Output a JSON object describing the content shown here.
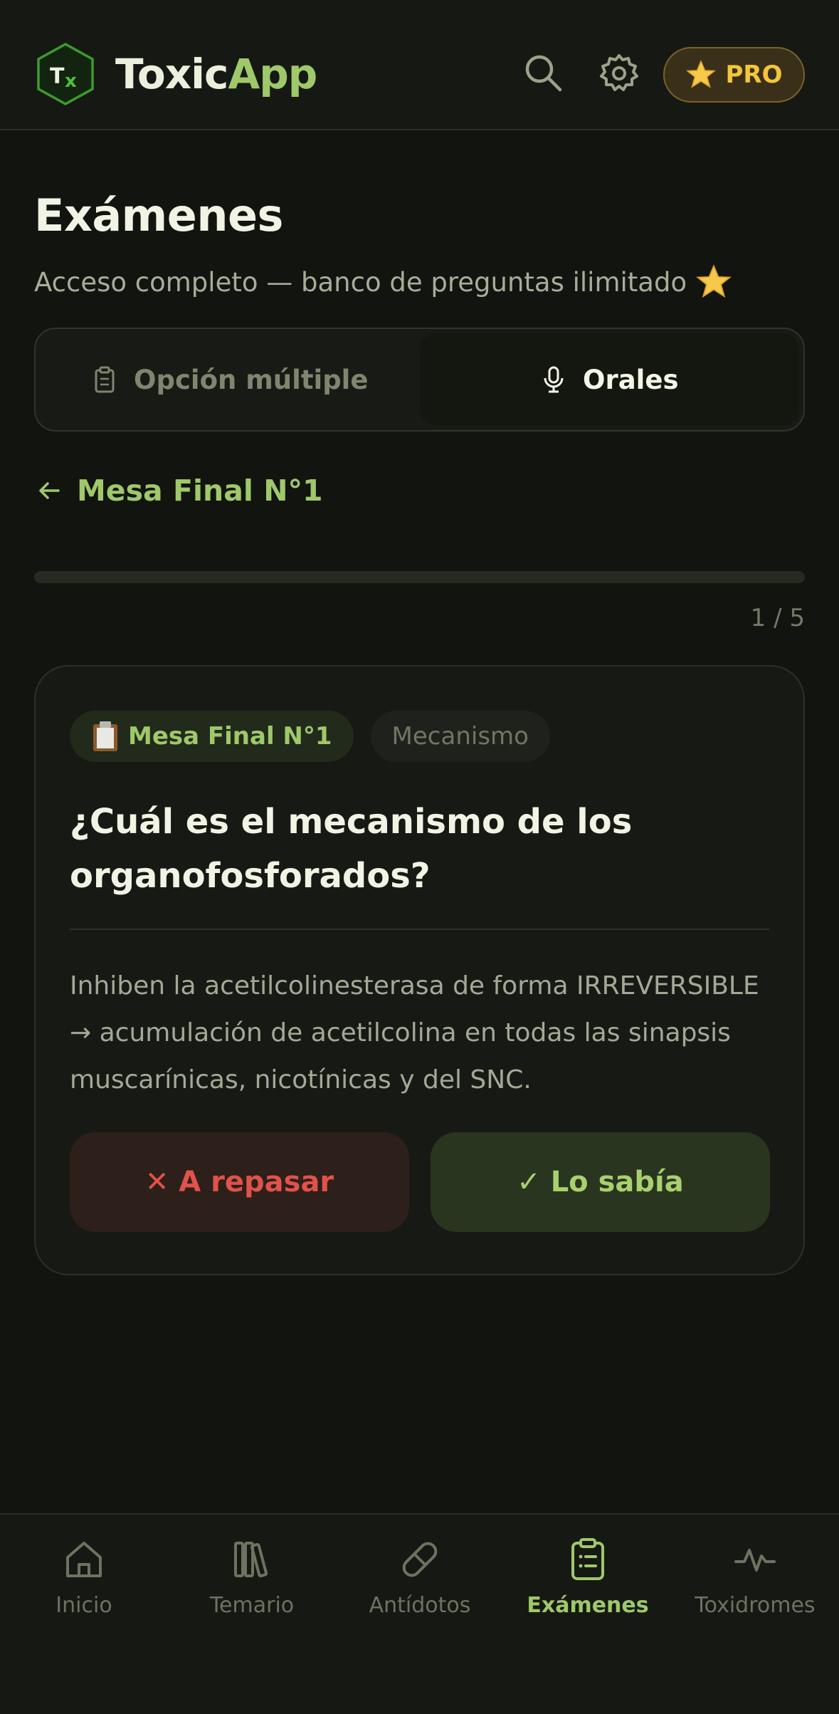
{
  "header": {
    "logo_text": "Tx",
    "brand_part1": "Toxic",
    "brand_part2": "App",
    "pro_label": "PRO"
  },
  "page": {
    "title": "Exámenes",
    "subtitle": "Acceso completo — banco de preguntas ilimitado"
  },
  "tabs": [
    {
      "label": "Opción múltiple",
      "icon": "clipboard-icon",
      "active": false
    },
    {
      "label": "Orales",
      "icon": "microphone-icon",
      "active": true
    }
  ],
  "back_link": {
    "label": "Mesa Final N°1"
  },
  "progress": {
    "current": 1,
    "total": 5,
    "text": "1 / 5"
  },
  "card": {
    "chip_exam": "Mesa Final N°1",
    "chip_category": "Mecanismo",
    "question": "¿Cuál es el mecanismo de los organofosforados?",
    "answer": "Inhiben la acetilcolinesterasa de forma IRREVERSIBLE → acumulación de acetilcolina en todas las sinapsis muscarínicas, nicotínicas y del SNC.",
    "btn_review": "✕ A repasar",
    "btn_knew": "✓ Lo sabía"
  },
  "nav": [
    {
      "label": "Inicio",
      "icon": "home-icon",
      "active": false
    },
    {
      "label": "Temario",
      "icon": "books-icon",
      "active": false
    },
    {
      "label": "Antídotos",
      "icon": "pill-icon",
      "active": false
    },
    {
      "label": "Exámenes",
      "icon": "clipboard-list-icon",
      "active": true
    },
    {
      "label": "Toxidromes",
      "icon": "activity-icon",
      "active": false
    }
  ],
  "colors": {
    "background": "#121410",
    "accent_green": "#9fc86a",
    "pro_gold": "#f2c53d",
    "danger_red": "#e0524a"
  }
}
